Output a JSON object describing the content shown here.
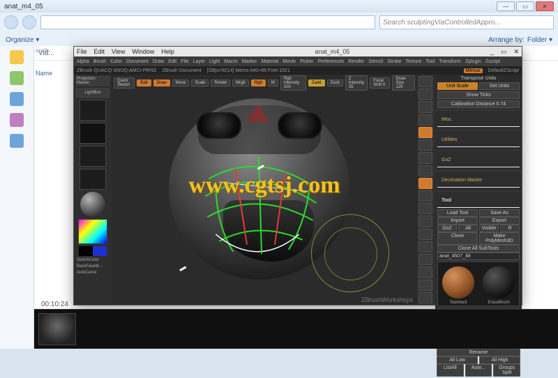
{
  "window": {
    "title": "anat_m4_05"
  },
  "explorer": {
    "search_placeholder": "Search sculptingViaControlledAppro...",
    "organize": "Organize ▾",
    "arrange_label": "Arrange by:",
    "arrange_value": "Folder ▾",
    "columns": {
      "c1": "Vid...",
      "c2": "sculp..."
    },
    "name_col": "Name",
    "item_label": "Vid",
    "timecode": "00:10:24"
  },
  "zbrush": {
    "menu": {
      "file": "File",
      "edit": "Edit",
      "view": "View",
      "window": "Window",
      "help": "Help",
      "center": "anat_m4_05"
    },
    "shelf": [
      "Alpha",
      "Brush",
      "Color",
      "Document",
      "Draw",
      "Edit",
      "File",
      "Layer",
      "Light",
      "Macro",
      "Marker",
      "Material",
      "Movie",
      "Picker",
      "Preferences",
      "Render",
      "Stencil",
      "Stroke",
      "Texture",
      "Tool",
      "Transform",
      "Zplugin",
      "Zscript"
    ],
    "infobar": {
      "left": "ZBrush QUACQ-SNUQ-AMCI-PRNS",
      "doc": "ZBrush Document",
      "stats": "[OBjs=9214] Mems:440+89 Free:1921",
      "menus": "Menus",
      "script": "DefaultZScript"
    },
    "leftpanel": {
      "projection": "Projection\nMaster",
      "lightbox": "LightBox",
      "switchcolor": "SwitchColor",
      "backface": "BackFaceM...",
      "autocurve": "AutoCurve"
    },
    "topopts": {
      "quick": "Quick\nSketch",
      "edit": "Edit",
      "draw": "Draw",
      "move": "Move",
      "scale": "Scale",
      "rotate": "Rotate",
      "mrgb": "Mrgb",
      "rgb": "Rgb",
      "m": "M",
      "rgbint": "Rgb Intensity 100",
      "zadd": "Zadd",
      "zsub": "Zsub",
      "zint": "Z Intensity 25",
      "focal": "Focal Shift 0",
      "drawsize": "Draw Size 129"
    },
    "rightpanel": {
      "transpose": "Transpose Units",
      "scale_cal": "Unit Scale",
      "set_units": "Set Units",
      "show_ticks": "Show Ticks",
      "cal_dist": "Calibration Distance 0.74",
      "misc": "Misc",
      "utilities": "Utilities",
      "goz": "GoZ",
      "decimation": "Decimation Master",
      "tool_hdr": "Tool",
      "load_tool": "Load Tool",
      "save_as": "Save As",
      "import": "Import",
      "export": "Export",
      "goz_btn": "GoZ",
      "all": "All",
      "visible": "Visible",
      "r": "R",
      "clone": "Clone",
      "polymesh": "Make PolyMesh3D",
      "clone_all": "Clone All SubTools",
      "toolname": "anat_4507_48",
      "brush1": "Standard",
      "brush2": "EraseBrush",
      "rename": "Rename",
      "all_low": "All Low",
      "all_high": "All High",
      "list_all": "ListAll",
      "auto": "Auto...",
      "groups": "Groups Split"
    },
    "watermark": "www.cgtsj.com",
    "wshopmark": "ZBrushWorkshops"
  }
}
